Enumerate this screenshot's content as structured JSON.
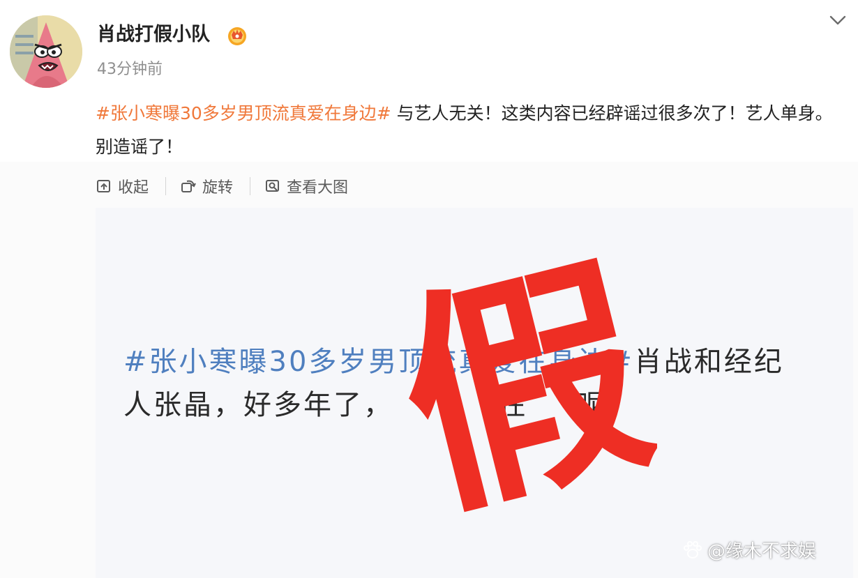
{
  "post": {
    "username": "肖战打假小队",
    "timestamp": "43分钟前",
    "hashtag": "#张小寒曝30多岁男顶流真爱在身边#",
    "body": "与艺人无关！这类内容已经辟谣过很多次了！艺人单身。别造谣了！",
    "accent_color": "#f0783a"
  },
  "toolbar": {
    "collapse_label": "收起",
    "rotate_label": "旋转",
    "view_large_label": "查看大图"
  },
  "image": {
    "hashtag": "#张小寒曝30多岁男顶流真爱在身边#",
    "line1_rest": "肖战和经纪",
    "line2_a": "人张晶，好多年了，",
    "line2_b": "在",
    "line2_c": "呢",
    "stamp_text": "假",
    "stamp_color": "#ee2e24"
  },
  "watermark": {
    "text": "@缘木不求娱"
  },
  "icons": {
    "menu": "chevron-down-icon",
    "badge": "vip-crown-icon",
    "collapse": "collapse-icon",
    "rotate": "rotate-icon",
    "view": "view-large-icon",
    "watermark": "paw-icon"
  }
}
